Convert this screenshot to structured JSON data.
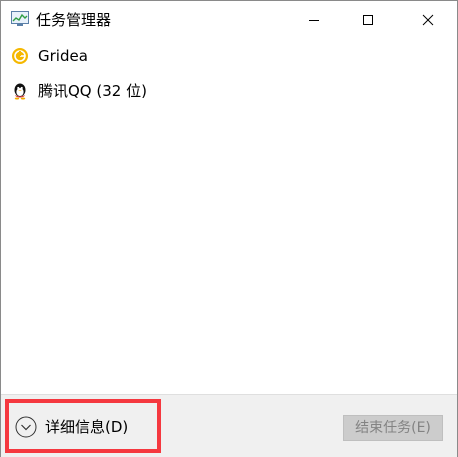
{
  "window": {
    "title": "任务管理器",
    "app_icon": "task-manager-icon"
  },
  "caption_buttons": {
    "minimize": "minimize-icon",
    "maximize": "maximize-icon",
    "close": "close-icon"
  },
  "apps": [
    {
      "label": "Gridea",
      "icon": "gridea-icon"
    },
    {
      "label": "腾讯QQ (32 位)",
      "icon": "qq-penguin-icon"
    }
  ],
  "footer": {
    "details_label": "详细信息(D)",
    "details_icon": "chevron-down-circle-icon",
    "end_task_label": "结束任务(E)",
    "highlight_color": "#f5383f"
  },
  "colors": {
    "accent_gridea": "#f5b800",
    "disabled_button_bg": "#cccccc",
    "disabled_button_text": "#838383"
  }
}
